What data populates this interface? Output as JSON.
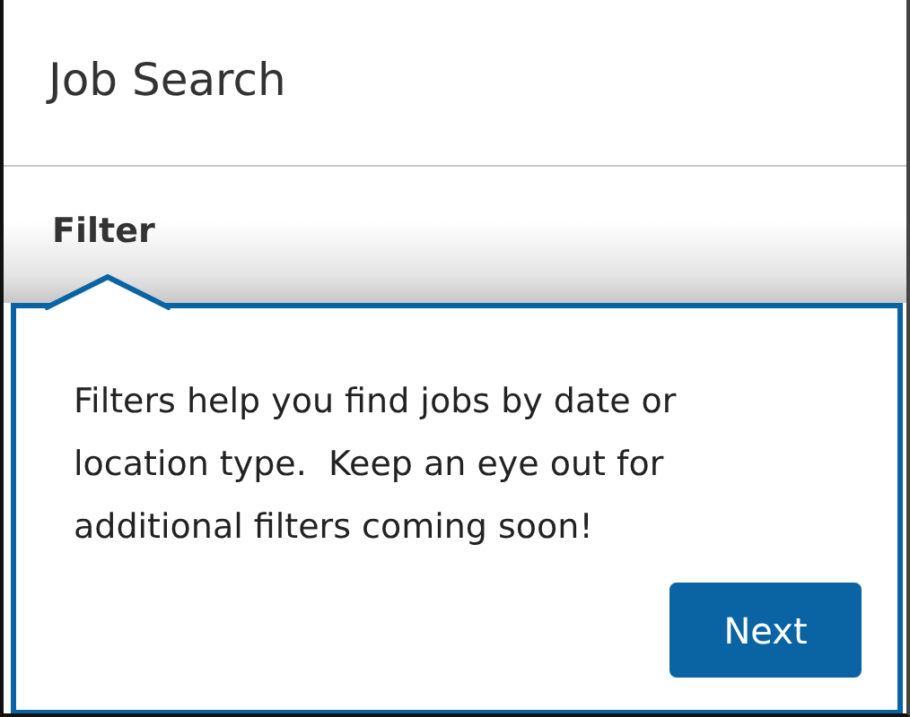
{
  "header": {
    "title": "Job Search"
  },
  "section": {
    "label": "Filter"
  },
  "tooltip": {
    "text": "Filters help you find jobs by date or location type.  Keep an eye out for additional filters coming soon!",
    "button": "Next"
  }
}
